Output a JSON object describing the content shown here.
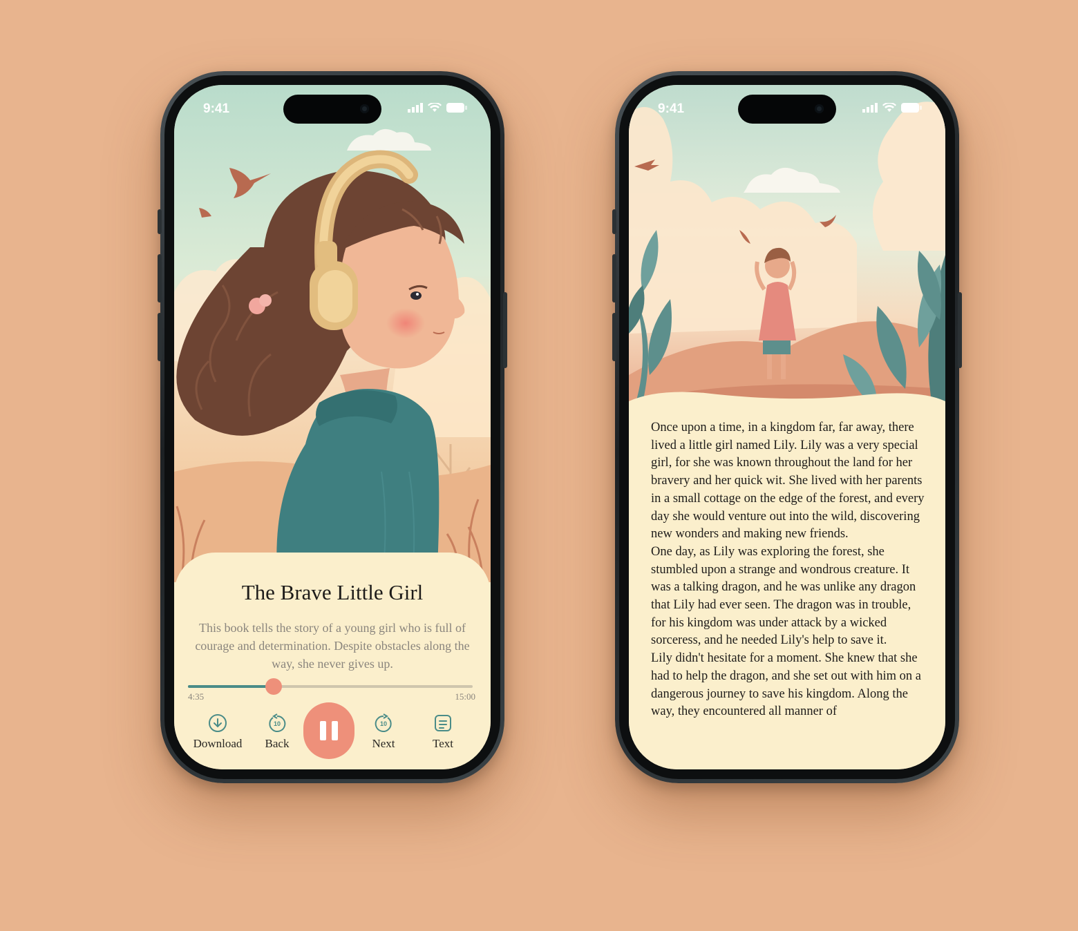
{
  "player_screen": {
    "status_time": "9:41",
    "title": "The Brave Little Girl",
    "description": "This book tells the story of a young girl who is full of courage and determination. Despite obstacles along the way, she never gives up.",
    "elapsed": "4:35",
    "total": "15:00",
    "progress_fraction": 0.3,
    "controls": {
      "download": "Download",
      "back": "Back",
      "next": "Next",
      "text": "Text",
      "skip_seconds": "10"
    }
  },
  "reader_screen": {
    "status_time": "9:41",
    "paragraphs": [
      "Once upon a time, in a kingdom far, far away, there lived a little girl named Lily. Lily was a very special girl, for she was known throughout the land for her bravery and her quick wit. She lived with her parents in a small cottage on the edge of the forest, and every day she would venture out into the wild, discovering new wonders and making new friends.",
      "One day, as Lily was exploring the forest, she stumbled upon a strange and wondrous creature. It was a talking dragon, and he was unlike any dragon that Lily had ever seen. The dragon was in trouble, for his kingdom was under attack by a wicked sorceress, and he needed Lily's help to save it.",
      "Lily didn't hesitate for a moment. She knew that she had to help the dragon, and she set out with him on a dangerous journey to save his kingdom. Along the way, they encountered all manner of"
    ]
  },
  "colors": {
    "background": "#e8b48e",
    "paper": "#fbefcc",
    "accent": "#ee907a",
    "teal": "#4a8c88"
  },
  "icons": [
    "download-icon",
    "replay-10-icon",
    "forward-10-icon",
    "text-icon",
    "pause-icon",
    "signal-icon",
    "wifi-icon",
    "battery-icon"
  ]
}
